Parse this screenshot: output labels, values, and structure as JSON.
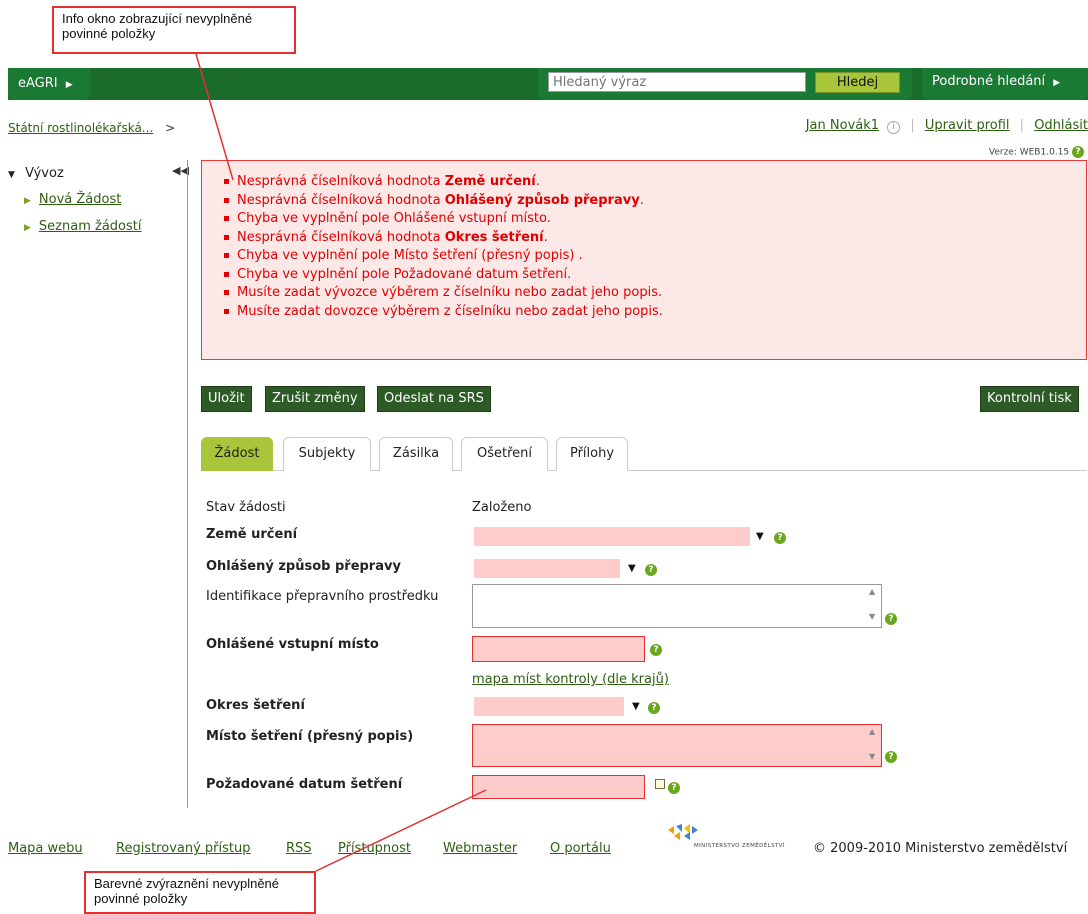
{
  "callouts": {
    "top": "Info okno zobrazující nevyplněné povinné položky",
    "bottom": "Barevné zvýraznění nevyplněné povinné položky"
  },
  "header": {
    "eagri": "eAGRI",
    "search_placeholder": "Hledaný výraz",
    "search_button": "Hledej",
    "advanced_search": "Podrobné hledání"
  },
  "breadcrumb": "Státní rostlinolékařská...",
  "user": {
    "name": "Jan Novák1",
    "edit_profile": "Upravit profil",
    "logout": "Odhlásit",
    "version": "Verze: WEB1.0.15"
  },
  "sidebar": {
    "section": "Vývoz",
    "items": [
      "Nová Žádost",
      "Seznam žádostí"
    ]
  },
  "errors": [
    {
      "text": "Nesprávná číselníková hodnota ",
      "bold": "Země určení",
      "tail": "."
    },
    {
      "text": "Nesprávná číselníková hodnota ",
      "bold": "Ohlášený způsob přepravy",
      "tail": "."
    },
    {
      "text": "Chyba ve vyplnění pole Ohlášené vstupní místo.",
      "bold": "",
      "tail": ""
    },
    {
      "text": "Nesprávná číselníková hodnota ",
      "bold": "Okres šetření",
      "tail": "."
    },
    {
      "text": "Chyba ve vyplnění pole Místo šetření (přesný popis) .",
      "bold": "",
      "tail": ""
    },
    {
      "text": "Chyba ve vyplnění pole Požadované datum šetření.",
      "bold": "",
      "tail": ""
    },
    {
      "text": "Musíte zadat vývozce výběrem z číselníku nebo zadat jeho popis.",
      "bold": "",
      "tail": ""
    },
    {
      "text": "Musíte zadat dovozce výběrem z číselníku nebo zadat jeho popis.",
      "bold": "",
      "tail": ""
    }
  ],
  "actions": {
    "save": "Uložit",
    "cancel": "Zrušit změny",
    "send": "Odeslat na SRS",
    "print": "Kontrolní tisk"
  },
  "tabs": [
    "Žádost",
    "Subjekty",
    "Zásilka",
    "Ošetření",
    "Přílohy"
  ],
  "form": {
    "status_label": "Stav žádosti",
    "status_value": "Založeno",
    "country_label": "Země určení",
    "transport_label": "Ohlášený způsob přepravy",
    "vehicle_label": "Identifikace přepravního prostředku",
    "entry_label": "Ohlášené vstupní místo",
    "map_link": "mapa míst kontroly (dle krajů)",
    "district_label": "Okres šetření",
    "place_label": "Místo šetření (přesný popis)",
    "date_label": "Požadované datum šetření"
  },
  "footer": {
    "links": [
      "Mapa webu",
      "Registrovaný přístup",
      "RSS",
      "Přístupnost",
      "Webmaster",
      "O portálu"
    ],
    "ministry_logo_text": "MINISTERSTVO ZEMĚDĚLSTVÍ",
    "copyright": "© 2009-2010 Ministerstvo zemědělství"
  },
  "colors": {
    "header_green": "#1b6b2c",
    "button_green": "#2e5a27",
    "accent_lime": "#a9c63b",
    "error_red": "#e10000",
    "error_bg": "#fde8e8",
    "invalid_field": "#ffcccc"
  }
}
